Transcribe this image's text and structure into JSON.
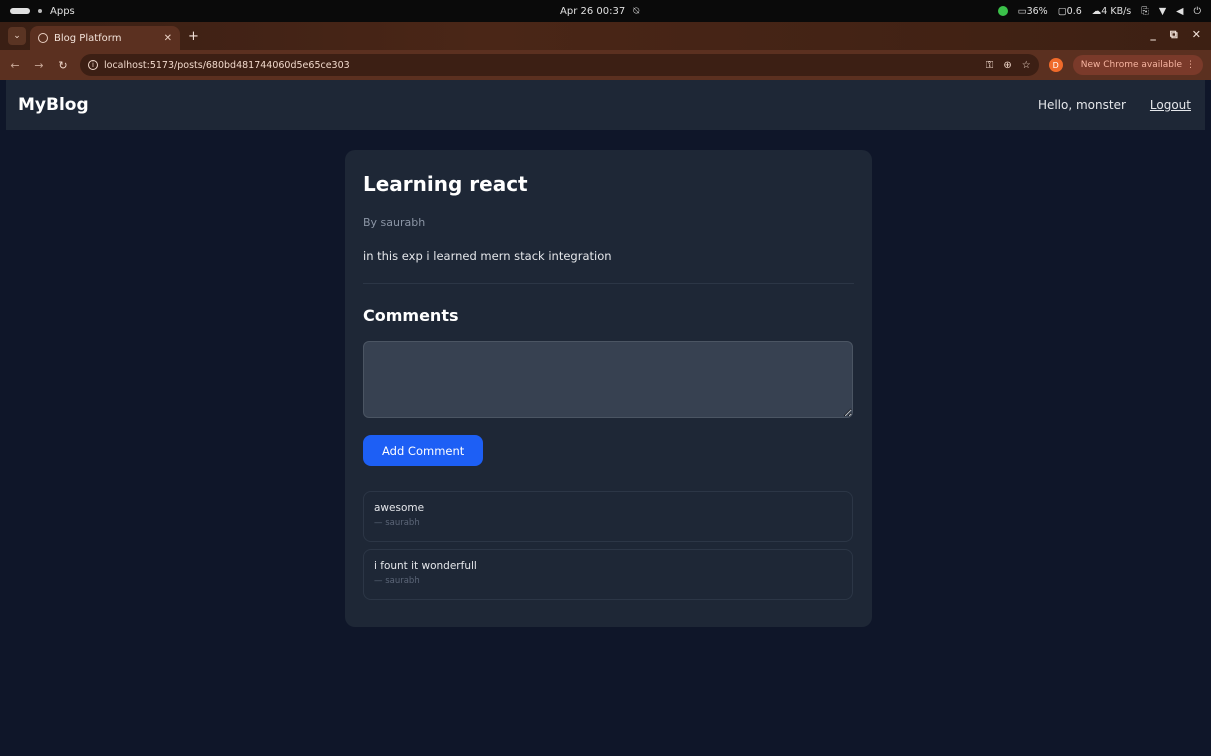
{
  "os": {
    "workspace": "Apps",
    "datetime": "Apr 26 00:37",
    "battery": "36%",
    "cpu": "0.6",
    "network": "4 KB/s"
  },
  "browser": {
    "tab_title": "Blog Platform",
    "url": "localhost:5173/posts/680bd481744060d5e65ce303",
    "update_label": "New Chrome available",
    "profile_initial": "D"
  },
  "nav": {
    "brand": "MyBlog",
    "greeting": "Hello, monster",
    "logout": "Logout"
  },
  "post": {
    "title": "Learning react",
    "author": "By saurabh",
    "body": "in this exp i learned mern stack integration"
  },
  "comments": {
    "heading": "Comments",
    "input_value": "",
    "submit_label": "Add Comment",
    "items": [
      {
        "text": "awesome",
        "author": "— saurabh"
      },
      {
        "text": "i fount it wonderfull",
        "author": "— saurabh"
      }
    ]
  }
}
